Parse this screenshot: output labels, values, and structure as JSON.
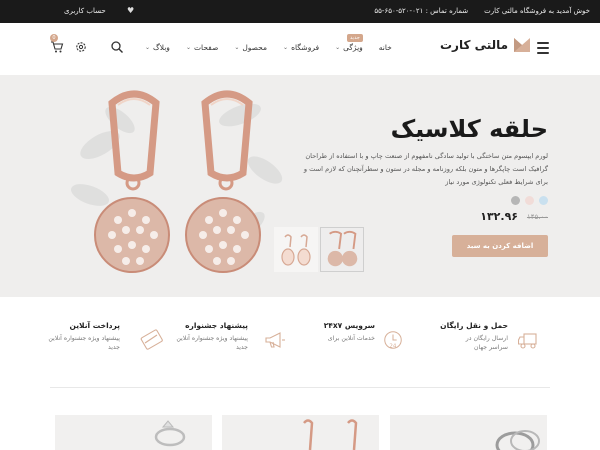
{
  "topbar": {
    "welcome": "خوش آمدید به فروشگاه مالتی کارت",
    "phone": "شماره تماس : ۰۲۱-۵۲۰-۶۵۰-۵۵",
    "account": "حساب کاربری"
  },
  "header": {
    "logo_text": "مالتی کارت",
    "nav": [
      {
        "label": "خانه",
        "has_menu": false
      },
      {
        "label": "ویژگی",
        "has_menu": true,
        "badge": "جدید"
      },
      {
        "label": "فروشگاه",
        "has_menu": true
      },
      {
        "label": "محصول",
        "has_menu": true
      },
      {
        "label": "صفحات",
        "has_menu": true
      },
      {
        "label": "وبلاگ",
        "has_menu": true
      }
    ],
    "cart_count": "0",
    "chevron": "⌄"
  },
  "hero": {
    "title": "حلقه کلاسیک",
    "description": "لورم ایپسوم متن ساختگی با تولید سادگی نامفهوم از صنعت چاپ و با استفاده از طراحان گرافیک است چاپگرها و متون بلکه روزنامه و مجله در ستون و سطرآنچنان که لازم است و برای شرایط فعلی تکنولوژی مورد نیاز",
    "swatches": [
      "#c9e0ef",
      "#f1dcd8",
      "#b6b6b6"
    ],
    "price": "۱۳۲.۹۶",
    "old_price": "۱۴۵.۰۰",
    "button": "اضافه کردن به سبد"
  },
  "features": [
    {
      "title": "حمل و نقل رایگان",
      "desc": "ارسال رایگان در سراسر جهان",
      "icon": "truck-icon"
    },
    {
      "title": "سرویس ۲۴x۷",
      "desc": "خدمات آنلاین برای",
      "icon": "clock-24-icon"
    },
    {
      "title": "پیشنهاد جشنواره",
      "desc": "پیشنهاد ویژه جشنواره آنلاین جدید",
      "icon": "megaphone-icon"
    },
    {
      "title": "پرداخت آنلاین",
      "desc": "پیشنهاد ویژه جشنواره آنلاین جدید",
      "icon": "credit-card-icon"
    }
  ],
  "colors": {
    "accent": "#d7b099",
    "topbar": "#1a1a1a",
    "hero_bg": "#efeeed"
  }
}
